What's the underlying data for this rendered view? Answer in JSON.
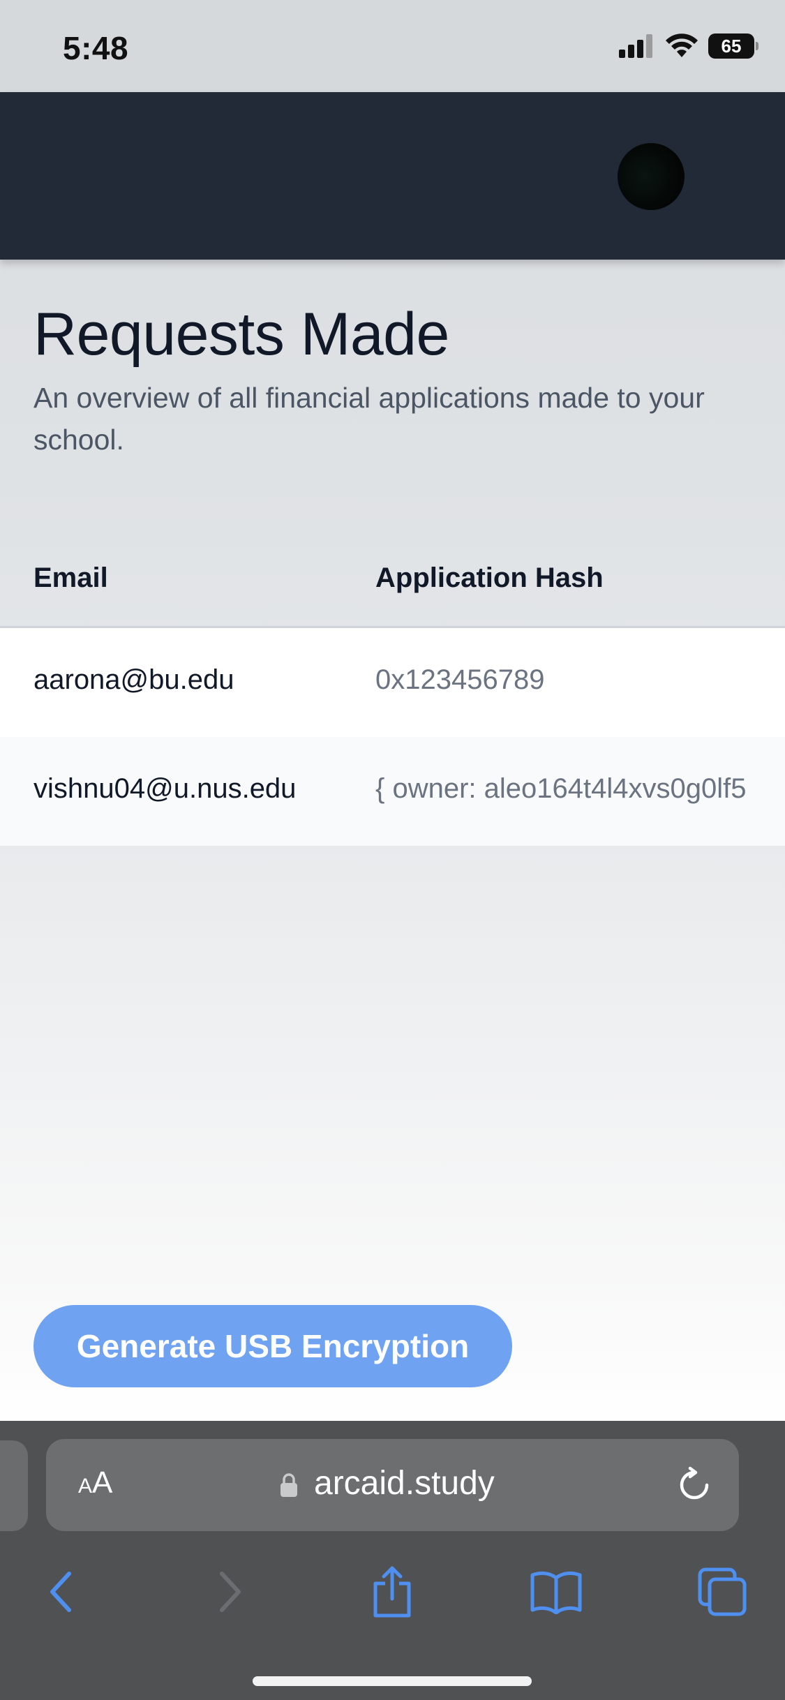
{
  "status_bar": {
    "time": "5:48",
    "battery": "65",
    "icons": [
      "cellular-signal-icon",
      "wifi-icon",
      "battery-icon"
    ]
  },
  "page": {
    "title": "Requests Made",
    "subtitle": "An overview of all financial applications made to your school."
  },
  "table": {
    "columns": [
      "Email",
      "Application Hash"
    ],
    "rows": [
      {
        "email": "aarona@bu.edu",
        "hash": "0x123456789"
      },
      {
        "email": "vishnu04@u.nus.edu",
        "hash": "{ owner: aleo164t4l4xvs0g0lf5"
      }
    ]
  },
  "actions": {
    "generate_label": "Generate USB Encryption"
  },
  "browser": {
    "aa_label_small": "A",
    "aa_label_large": "A",
    "url": "arcaid.study",
    "toolbar_icons": [
      "back-icon",
      "forward-icon",
      "share-icon",
      "bookmarks-icon",
      "tabs-icon"
    ]
  },
  "colors": {
    "header_bg": "#222937",
    "button_bg": "#6fa3f2",
    "safari_icon_blue": "#4f8ff0"
  }
}
